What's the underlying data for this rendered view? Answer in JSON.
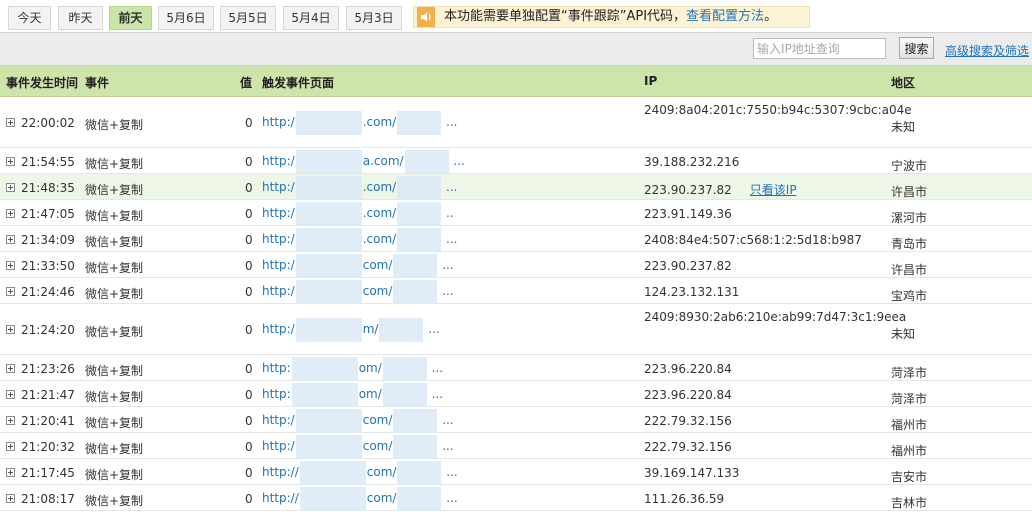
{
  "tabs": [
    "今天",
    "昨天",
    "前天",
    "5月6日",
    "5月5日",
    "5月4日",
    "5月3日"
  ],
  "active_tab": 2,
  "notice": {
    "text": "本功能需要单独配置“事件跟踪”API代码，",
    "link": "查看配置方法",
    "tail": "。"
  },
  "search": {
    "placeholder": "输入IP地址查询",
    "button": "搜索",
    "advanced_link": "高级搜索及筛选"
  },
  "columns": {
    "time": "事件发生时间",
    "event": "事件",
    "value": "值",
    "page": "触发事件页面",
    "ip": "IP",
    "region": "地区"
  },
  "only_ip_label": "只看该IP",
  "rows": [
    {
      "time": "22:00:02",
      "event": "微信+复制",
      "value": "0",
      "url_start": "http:/",
      "url_mid": ".com/",
      "url_end": "...",
      "ip": "2409:8a04:201c:7550:b94c:5307:9cbc:a04e",
      "region": "未知",
      "tall": true
    },
    {
      "time": "21:54:55",
      "event": "微信+复制",
      "value": "0",
      "url_start": "http:/",
      "url_mid": "a.com/",
      "url_end": "...",
      "ip": "39.188.232.216",
      "region": "宁波市",
      "tall": false
    },
    {
      "time": "21:48:35",
      "event": "微信+复制",
      "value": "0",
      "url_start": "http:/",
      "url_mid": ".com/",
      "url_end": "...",
      "ip": "223.90.237.82",
      "region": "许昌市",
      "tall": false,
      "highlight": true
    },
    {
      "time": "21:47:05",
      "event": "微信+复制",
      "value": "0",
      "url_start": "http:/",
      "url_mid": ".com/",
      "url_end": "..",
      "ip": "223.91.149.36",
      "region": "漯河市",
      "tall": false
    },
    {
      "time": "21:34:09",
      "event": "微信+复制",
      "value": "0",
      "url_start": "http:/",
      "url_mid": ".com/",
      "url_end": "...",
      "ip": "2408:84e4:507:c568:1:2:5d18:b987",
      "region": "青岛市",
      "tall": false
    },
    {
      "time": "21:33:50",
      "event": "微信+复制",
      "value": "0",
      "url_start": "http:/",
      "url_mid": "com/",
      "url_end": "...",
      "ip": "223.90.237.82",
      "region": "许昌市",
      "tall": false
    },
    {
      "time": "21:24:46",
      "event": "微信+复制",
      "value": "0",
      "url_start": "http:/",
      "url_mid": "com/",
      "url_end": "...",
      "ip": "124.23.132.131",
      "region": "宝鸡市",
      "tall": false
    },
    {
      "time": "21:24:20",
      "event": "微信+复制",
      "value": "0",
      "url_start": "http:/",
      "url_mid": "m/",
      "url_end": "...",
      "ip": "2409:8930:2ab6:210e:ab99:7d47:3c1:9eea",
      "region": "未知",
      "tall": true
    },
    {
      "time": "21:23:26",
      "event": "微信+复制",
      "value": "0",
      "url_start": "http:",
      "url_mid": "om/",
      "url_end": "...",
      "ip": "223.96.220.84",
      "region": "菏泽市",
      "tall": false
    },
    {
      "time": "21:21:47",
      "event": "微信+复制",
      "value": "0",
      "url_start": "http:",
      "url_mid": "om/",
      "url_end": "...",
      "ip": "223.96.220.84",
      "region": "菏泽市",
      "tall": false
    },
    {
      "time": "21:20:41",
      "event": "微信+复制",
      "value": "0",
      "url_start": "http:/",
      "url_mid": "com/",
      "url_end": "...",
      "ip": "222.79.32.156",
      "region": "福州市",
      "tall": false
    },
    {
      "time": "21:20:32",
      "event": "微信+复制",
      "value": "0",
      "url_start": "http:/",
      "url_mid": "com/",
      "url_end": "...",
      "ip": "222.79.32.156",
      "region": "福州市",
      "tall": false
    },
    {
      "time": "21:17:45",
      "event": "微信+复制",
      "value": "0",
      "url_start": "http://",
      "url_mid": "com/",
      "url_end": "...",
      "ip": "39.169.147.133",
      "region": "吉安市",
      "tall": false
    },
    {
      "time": "21:08:17",
      "event": "微信+复制",
      "value": "0",
      "url_start": "http://",
      "url_mid": "com/",
      "url_end": "...",
      "ip": "111.26.36.59",
      "region": "吉林市",
      "tall": false
    }
  ]
}
